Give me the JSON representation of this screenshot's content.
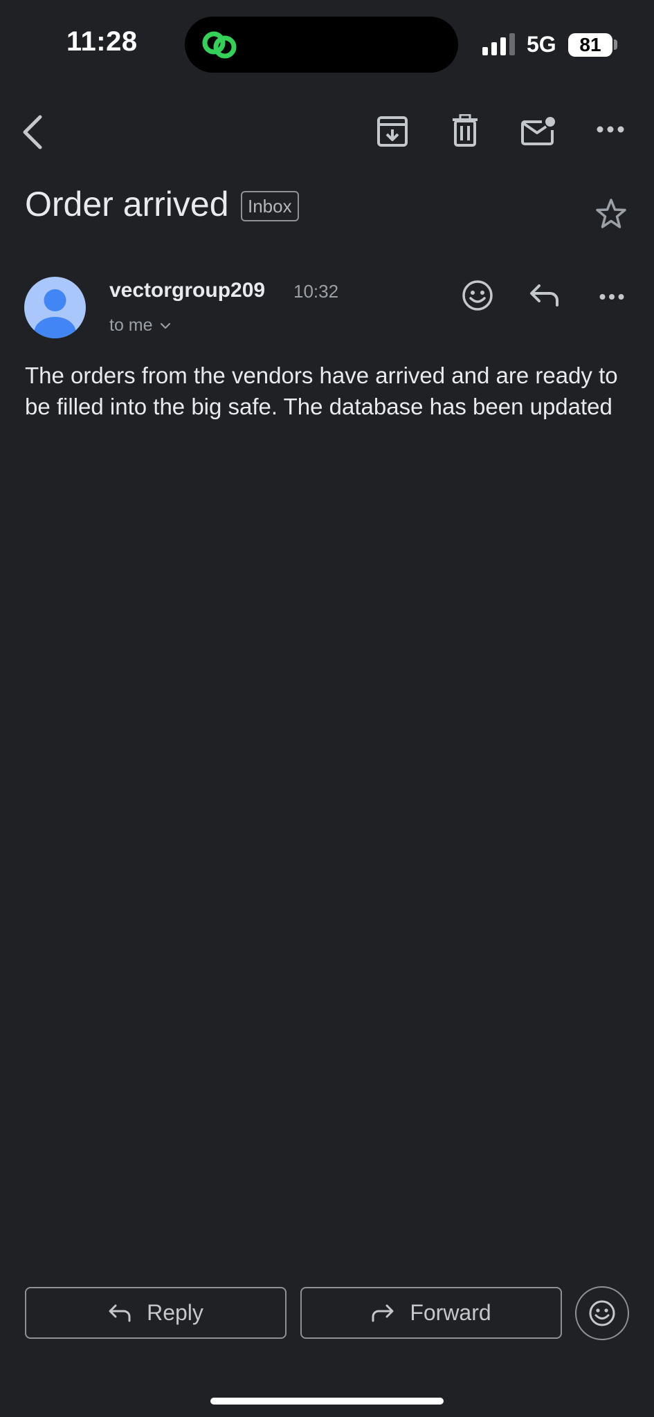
{
  "status_bar": {
    "time": "11:28",
    "network": "5G",
    "battery": "81"
  },
  "toolbar": {
    "icons": [
      "back-icon",
      "archive-icon",
      "delete-icon",
      "mark-unread-icon",
      "more-icon"
    ]
  },
  "email": {
    "subject": "Order arrived",
    "label": "Inbox",
    "sender": "vectorgroup209",
    "time": "10:32",
    "recipient": "to me",
    "body": "The orders from the vendors have arrived and are ready to be filled into the big safe. The database has been updated"
  },
  "actions": {
    "reply_label": "Reply",
    "forward_label": "Forward"
  },
  "colors": {
    "background": "#202124",
    "text": "#e8eaed",
    "secondary_text": "#9aa0a6",
    "avatar_bg": "#a9c7fb",
    "avatar_fg": "#4285f4",
    "island_icon": "#34d058"
  }
}
